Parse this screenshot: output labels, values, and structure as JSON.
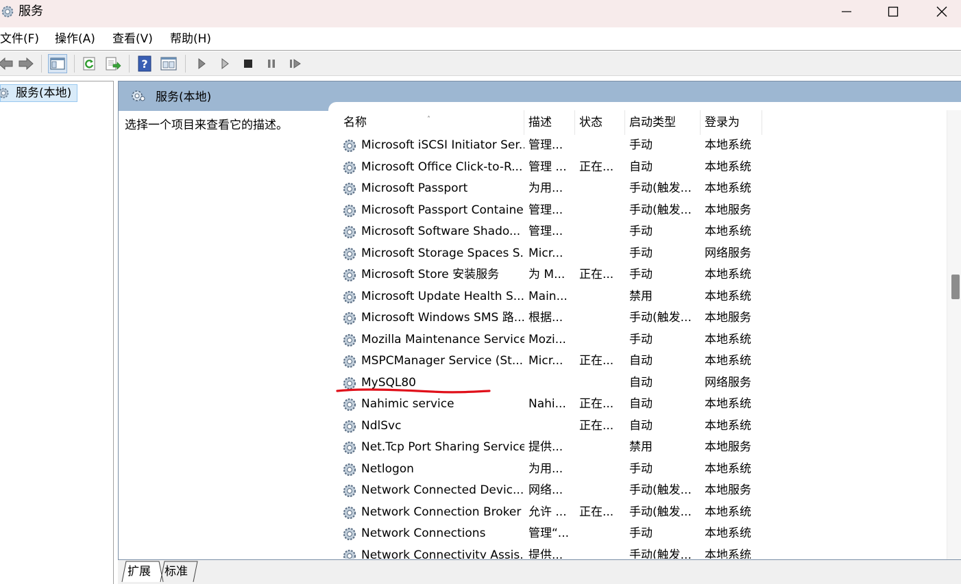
{
  "window": {
    "title": "服务"
  },
  "menu": {
    "items": [
      "文件(F)",
      "操作(A)",
      "查看(V)",
      "帮助(H)"
    ]
  },
  "toolbar": {
    "buttons": [
      "back-arrow-icon",
      "forward-arrow-icon",
      "show-hide-console-tree-icon",
      "refresh-icon",
      "export-list-icon",
      "help-icon",
      "properties-icon",
      "start-service-icon",
      "start-alt-icon",
      "stop-service-icon",
      "pause-service-icon",
      "resume-service-icon"
    ]
  },
  "tree": {
    "root_label": "服务(本地)"
  },
  "pane": {
    "title": "服务(本地)",
    "description": "选择一个项目来查看它的描述。"
  },
  "list": {
    "columns": [
      "名称",
      "描述",
      "状态",
      "启动类型",
      "登录为"
    ],
    "rows": [
      {
        "name": "Microsoft iSCSI Initiator Ser...",
        "desc": "管理...",
        "status": "",
        "startup": "手动",
        "logon": "本地系统"
      },
      {
        "name": "Microsoft Office Click-to-R...",
        "desc": "管理 ...",
        "status": "正在...",
        "startup": "自动",
        "logon": "本地系统"
      },
      {
        "name": "Microsoft Passport",
        "desc": "为用...",
        "status": "",
        "startup": "手动(触发...",
        "logon": "本地系统"
      },
      {
        "name": "Microsoft Passport Container",
        "desc": "管理...",
        "status": "",
        "startup": "手动(触发...",
        "logon": "本地服务"
      },
      {
        "name": "Microsoft Software Shado...",
        "desc": "管理...",
        "status": "",
        "startup": "手动",
        "logon": "本地系统"
      },
      {
        "name": "Microsoft Storage Spaces S...",
        "desc": "Micr...",
        "status": "",
        "startup": "手动",
        "logon": "网络服务"
      },
      {
        "name": "Microsoft Store 安装服务",
        "desc": "为 M...",
        "status": "正在...",
        "startup": "手动",
        "logon": "本地系统"
      },
      {
        "name": "Microsoft Update Health S...",
        "desc": "Main...",
        "status": "",
        "startup": "禁用",
        "logon": "本地系统"
      },
      {
        "name": "Microsoft Windows SMS 路...",
        "desc": "根据...",
        "status": "",
        "startup": "手动(触发...",
        "logon": "本地服务"
      },
      {
        "name": "Mozilla Maintenance Service",
        "desc": "Mozi...",
        "status": "",
        "startup": "手动",
        "logon": "本地系统"
      },
      {
        "name": "MSPCManager Service (St...",
        "desc": "Micr...",
        "status": "正在...",
        "startup": "自动",
        "logon": "本地系统"
      },
      {
        "name": "MySQL80",
        "desc": "",
        "status": "",
        "startup": "自动",
        "logon": "网络服务"
      },
      {
        "name": "Nahimic service",
        "desc": "Nahi...",
        "status": "正在...",
        "startup": "自动",
        "logon": "本地系统"
      },
      {
        "name": "NdlSvc",
        "desc": "",
        "status": "正在...",
        "startup": "自动",
        "logon": "本地系统"
      },
      {
        "name": "Net.Tcp Port Sharing Service",
        "desc": "提供...",
        "status": "",
        "startup": "禁用",
        "logon": "本地服务"
      },
      {
        "name": "Netlogon",
        "desc": "为用...",
        "status": "",
        "startup": "手动",
        "logon": "本地系统"
      },
      {
        "name": "Network Connected Devic...",
        "desc": "网络...",
        "status": "",
        "startup": "手动(触发...",
        "logon": "本地服务"
      },
      {
        "name": "Network Connection Broker",
        "desc": "允许 ...",
        "status": "正在...",
        "startup": "手动(触发...",
        "logon": "本地系统"
      },
      {
        "name": "Network Connections",
        "desc": "管理“...",
        "status": "",
        "startup": "手动",
        "logon": "本地系统"
      },
      {
        "name": "Network Connectivity Assis...",
        "desc": "提供...",
        "status": "",
        "startup": "手动(触发...",
        "logon": "本地系统"
      }
    ]
  },
  "tabs": [
    "扩展",
    "标准"
  ],
  "annotation": {
    "underline_color": "#e0101a"
  }
}
